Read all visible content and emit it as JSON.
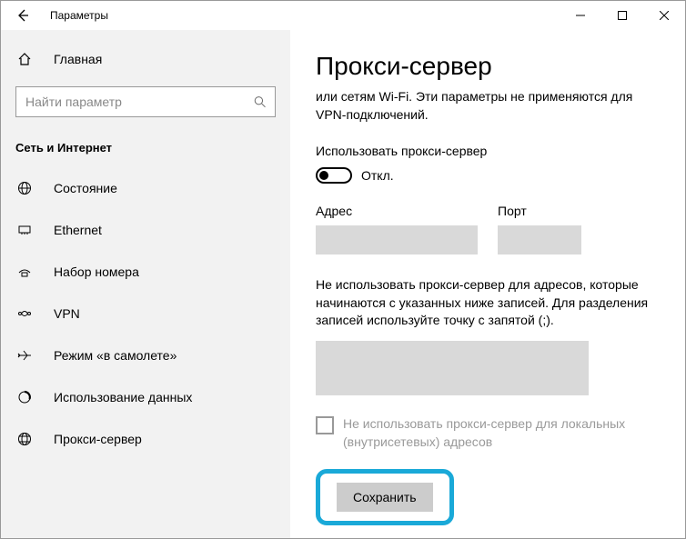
{
  "window": {
    "title": "Параметры"
  },
  "sidebar": {
    "home_label": "Главная",
    "search_placeholder": "Найти параметр",
    "category_header": "Сеть и Интернет",
    "items": [
      {
        "label": "Состояние"
      },
      {
        "label": "Ethernet"
      },
      {
        "label": "Набор номера"
      },
      {
        "label": "VPN"
      },
      {
        "label": "Режим «в самолете»"
      },
      {
        "label": "Использование данных"
      },
      {
        "label": "Прокси-сервер"
      }
    ]
  },
  "main": {
    "title": "Прокси-сервер",
    "description": "или сетям Wi-Fi. Эти параметры не применяются для VPN-подключений.",
    "use_proxy_label": "Использовать прокси-сервер",
    "toggle_state": "Откл.",
    "address_label": "Адрес",
    "port_label": "Порт",
    "exception_text": "Не использовать прокси-сервер для адресов, которые начинаются с указанных ниже записей. Для разделения записей используйте точку с запятой (;).",
    "bypass_local_label": "Не использовать прокси-сервер для локальных (внутрисетевых) адресов",
    "save_label": "Сохранить"
  }
}
